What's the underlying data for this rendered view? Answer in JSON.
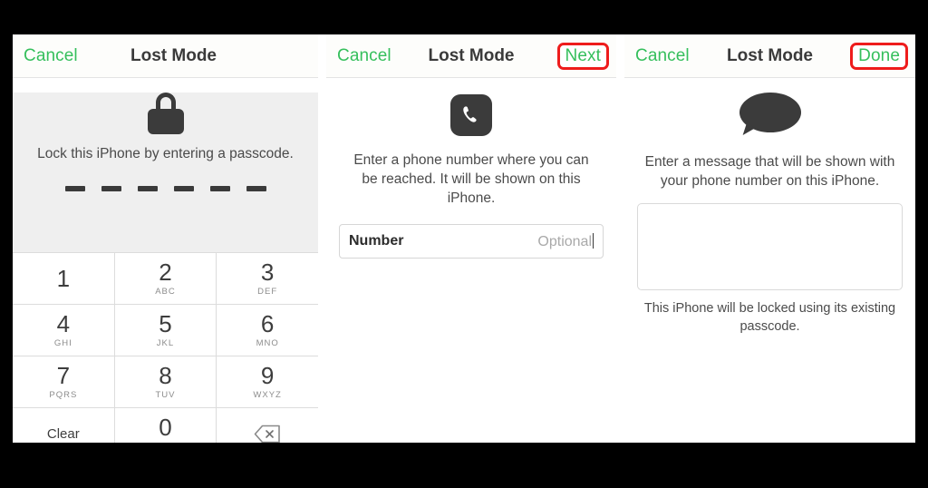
{
  "panels": [
    {
      "id": "passcode-panel",
      "nav": {
        "left_label": "Cancel",
        "title": "Lost Mode",
        "right_label": "",
        "right_highlighted": false
      },
      "caption": "Lock this iPhone by entering a passcode.",
      "passcode_digits": 6,
      "icon": "lock-icon",
      "keypad": [
        {
          "digit": "1",
          "letters": ""
        },
        {
          "digit": "2",
          "letters": "ABC"
        },
        {
          "digit": "3",
          "letters": "DEF"
        },
        {
          "digit": "4",
          "letters": "GHI"
        },
        {
          "digit": "5",
          "letters": "JKL"
        },
        {
          "digit": "6",
          "letters": "MNO"
        },
        {
          "digit": "7",
          "letters": "PQRS"
        },
        {
          "digit": "8",
          "letters": "TUV"
        },
        {
          "digit": "9",
          "letters": "WXYZ"
        },
        {
          "digit": "Clear",
          "letters": ""
        },
        {
          "digit": "0",
          "letters": "+"
        },
        {
          "digit": "",
          "letters": ""
        }
      ]
    },
    {
      "id": "phone-number-panel",
      "nav": {
        "left_label": "Cancel",
        "title": "Lost Mode",
        "right_label": "Next",
        "right_highlighted": true
      },
      "icon": "phone-icon",
      "instructions": "Enter a phone number where you can be reached. It will be shown on this iPhone.",
      "field": {
        "label": "Number",
        "placeholder": "Optional",
        "value": ""
      }
    },
    {
      "id": "message-panel",
      "nav": {
        "left_label": "Cancel",
        "title": "Lost Mode",
        "right_label": "Done",
        "right_highlighted": true
      },
      "icon": "speech-bubble-icon",
      "instructions": "Enter a message that will be shown with your phone number on this iPhone.",
      "message_value": "",
      "footnote": "This iPhone will be locked using its existing passcode."
    }
  ],
  "colors": {
    "accent_green": "#35bf5c",
    "highlight_red": "#ee1c1c",
    "icon_dark": "#3b3b3b",
    "panel_gray": "#efefef"
  }
}
